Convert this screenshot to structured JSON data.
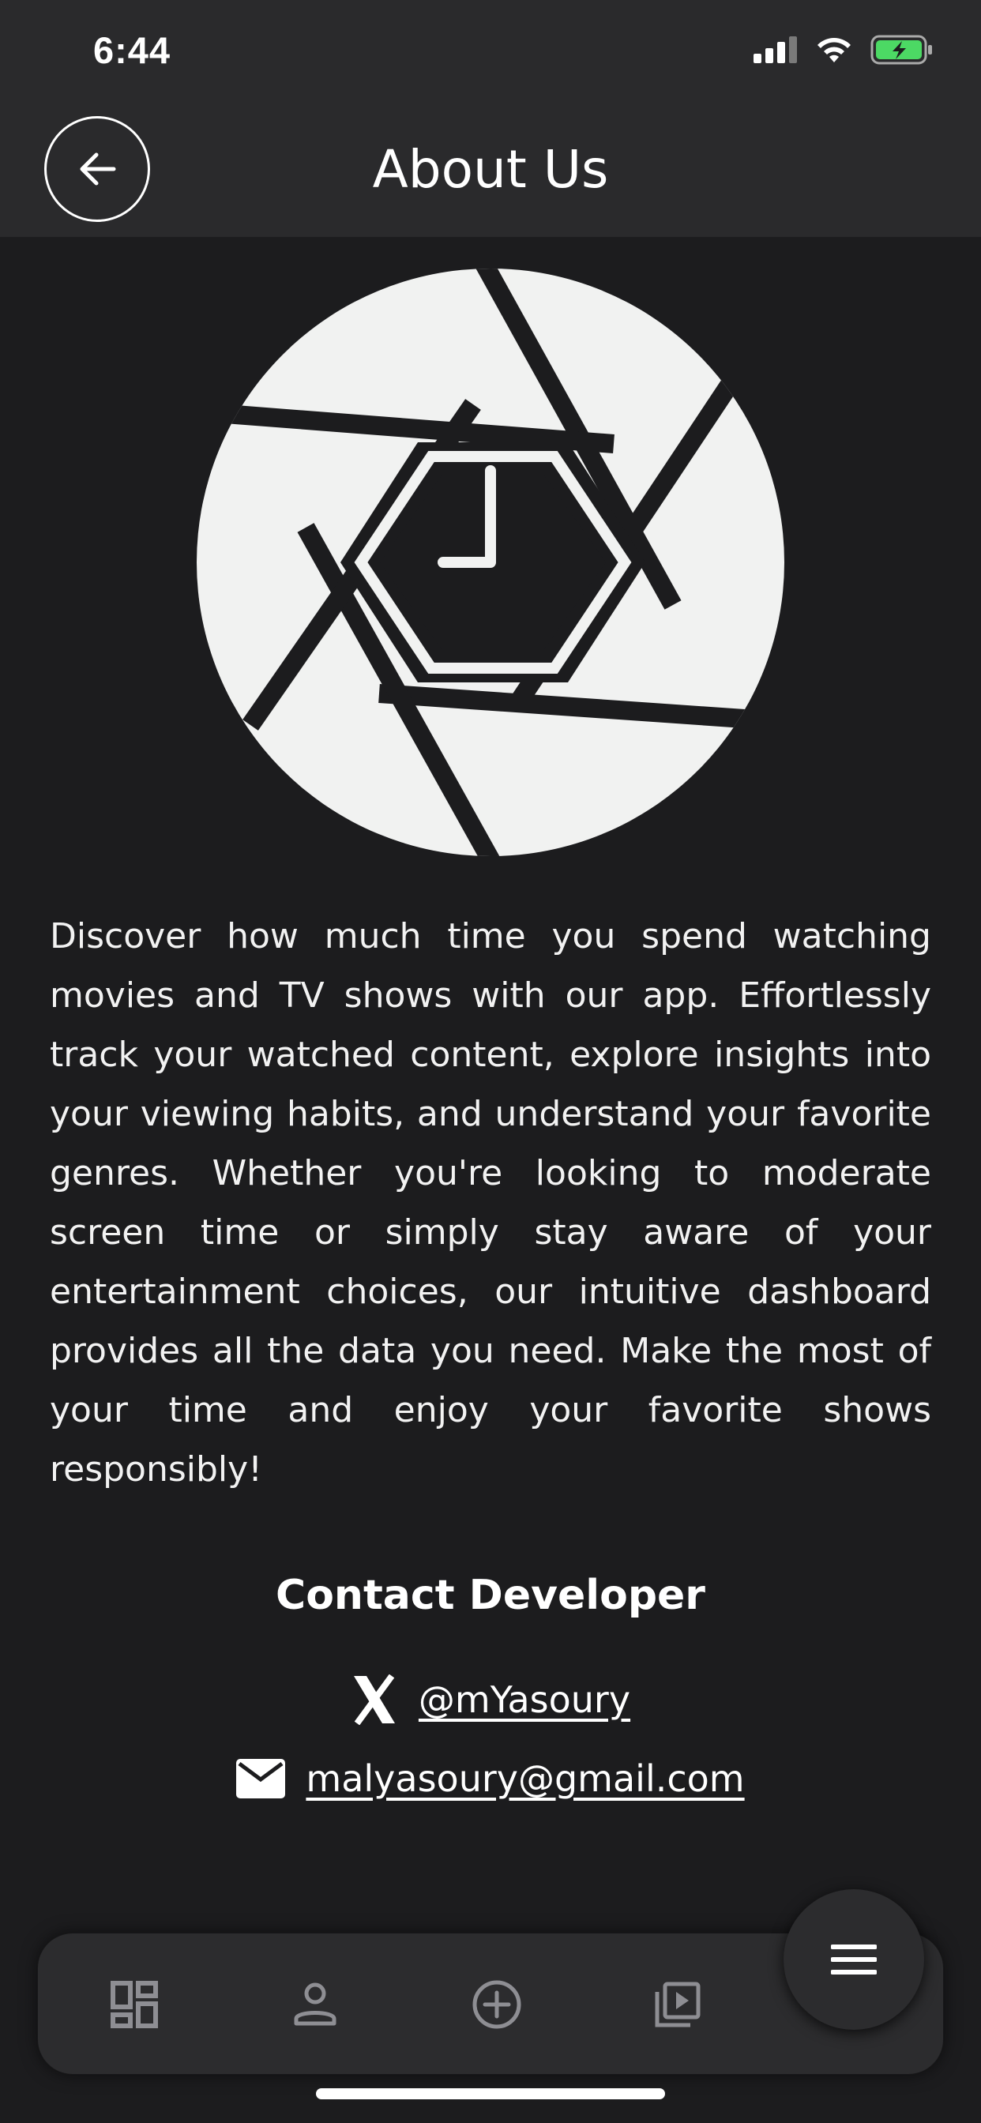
{
  "status_bar": {
    "time": "6:44",
    "icons": [
      "signal-icon",
      "wifi-icon",
      "battery-charging-icon"
    ],
    "battery_color": "#4cd964"
  },
  "header": {
    "title": "About Us",
    "back_icon": "arrow-left-icon"
  },
  "logo": {
    "icon": "camera-aperture-clock-icon"
  },
  "description": "Discover how much time you spend watching movies and TV shows with our app. Effortlessly track your watched content, explore insights into your viewing habits, and understand your favorite genres. Whether you're looking to moderate screen time or simply stay aware of your entertainment choices, our intuitive dashboard provides all the data you need. Make the most of your time and enjoy your favorite shows responsibly!",
  "contact": {
    "title": "Contact Developer",
    "twitter": {
      "icon": "x-logo-icon",
      "handle": "@mYasoury"
    },
    "email": {
      "icon": "mail-icon",
      "address": "malyasoury@gmail.com"
    }
  },
  "tab_bar": {
    "items": [
      {
        "icon": "dashboard-icon"
      },
      {
        "icon": "person-icon"
      },
      {
        "icon": "add-circle-icon"
      },
      {
        "icon": "video-library-icon"
      }
    ],
    "fab_icon": "menu-icon"
  },
  "colors": {
    "background": "#1c1c1e",
    "header": "#2a2a2c",
    "tab_bar": "#2c2c2e",
    "text": "#ffffff",
    "icon_muted": "#8e8e93"
  }
}
